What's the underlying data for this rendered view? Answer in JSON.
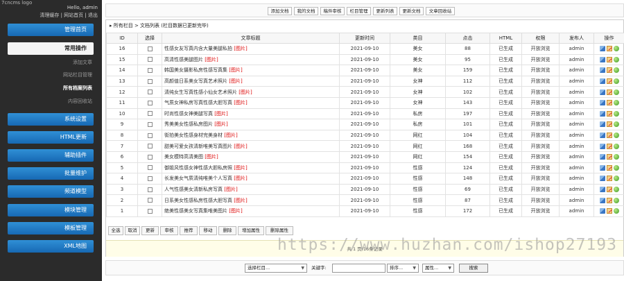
{
  "sidebar": {
    "logo": "7cncms logo",
    "hello": "Hello, admin",
    "links": [
      "清理缓存",
      "网站首页",
      "退出"
    ],
    "link_sep": "|",
    "items": [
      {
        "label": "管理首页",
        "type": "button"
      },
      {
        "label": "常用操作",
        "type": "white"
      },
      {
        "label": "添加文章",
        "type": "sub"
      },
      {
        "label": "网站栏目管理",
        "type": "sub"
      },
      {
        "label": "所有档案列表",
        "type": "sub-active"
      },
      {
        "label": "内容回收站",
        "type": "sub"
      },
      {
        "label": "系统设置",
        "type": "button"
      },
      {
        "label": "HTML更新",
        "type": "button"
      },
      {
        "label": "辅助插件",
        "type": "button"
      },
      {
        "label": "批量维护",
        "type": "button"
      },
      {
        "label": "频道模型",
        "type": "button"
      },
      {
        "label": "模块管理",
        "type": "button"
      },
      {
        "label": "模板管理",
        "type": "button"
      },
      {
        "label": "XML地图",
        "type": "button"
      }
    ]
  },
  "toolbar": [
    "添加文档",
    "我的文档",
    "稿件审核",
    "栏目管理",
    "更新列表",
    "更新文档",
    "文章回收站"
  ],
  "breadcrumb": "▸ 所有栏目 > 文档列表  (栏目数据已更新完毕)",
  "table": {
    "headers": [
      "ID",
      "选择",
      "文章标题",
      "更新时间",
      "类目",
      "点击",
      "HTML",
      "权限",
      "发布人",
      "操作"
    ],
    "pic_tag": "[图片]",
    "rows": [
      {
        "id": "16",
        "title": "性感女友写真内含大量美腿私拍",
        "date": "2021-09-10",
        "cat": "美女",
        "clicks": "88",
        "html": "已生成",
        "perm": "开放浏览",
        "author": "admin"
      },
      {
        "id": "15",
        "title": "高清性感美腿图片",
        "date": "2021-09-10",
        "cat": "美女",
        "clicks": "95",
        "html": "已生成",
        "perm": "开放浏览",
        "author": "admin"
      },
      {
        "id": "14",
        "title": "韩国美女摄影私房性感写真集",
        "date": "2021-09-10",
        "cat": "美女",
        "clicks": "159",
        "html": "已生成",
        "perm": "开放浏览",
        "author": "admin"
      },
      {
        "id": "13",
        "title": "高颜值日系美女写真艺术照片",
        "date": "2021-09-10",
        "cat": "女神",
        "clicks": "112",
        "html": "已生成",
        "perm": "开放浏览",
        "author": "admin"
      },
      {
        "id": "12",
        "title": "清纯女生写真性感小仙女艺术照片",
        "date": "2021-09-10",
        "cat": "女神",
        "clicks": "102",
        "html": "已生成",
        "perm": "开放浏览",
        "author": "admin"
      },
      {
        "id": "11",
        "title": "气质女神私房写真性感大胆写真",
        "date": "2021-09-10",
        "cat": "女神",
        "clicks": "143",
        "html": "已生成",
        "perm": "开放浏览",
        "author": "admin"
      },
      {
        "id": "10",
        "title": "时尚性感女神美腿写真",
        "date": "2021-09-10",
        "cat": "私房",
        "clicks": "197",
        "html": "已生成",
        "perm": "开放浏览",
        "author": "admin"
      },
      {
        "id": "9",
        "title": "秀美美女性感私房图片",
        "date": "2021-09-10",
        "cat": "私房",
        "clicks": "101",
        "html": "已生成",
        "perm": "开放浏览",
        "author": "admin"
      },
      {
        "id": "8",
        "title": "街拍美女性感身材完美身材",
        "date": "2021-09-10",
        "cat": "网红",
        "clicks": "104",
        "html": "已生成",
        "perm": "开放浏览",
        "author": "admin"
      },
      {
        "id": "7",
        "title": "甜美可爱女孩清新唯美写真图片",
        "date": "2021-09-10",
        "cat": "网红",
        "clicks": "168",
        "html": "已生成",
        "perm": "开放浏览",
        "author": "admin"
      },
      {
        "id": "6",
        "title": "美女模特高清美图",
        "date": "2021-09-10",
        "cat": "网红",
        "clicks": "154",
        "html": "已生成",
        "perm": "开放浏览",
        "author": "admin"
      },
      {
        "id": "5",
        "title": "御姐风性感女神性感大胆私房照",
        "date": "2021-09-10",
        "cat": "性感",
        "clicks": "124",
        "html": "已生成",
        "perm": "开放浏览",
        "author": "admin"
      },
      {
        "id": "4",
        "title": "长发美女气质清纯唯美个人写真",
        "date": "2021-09-10",
        "cat": "性感",
        "clicks": "148",
        "html": "已生成",
        "perm": "开放浏览",
        "author": "admin"
      },
      {
        "id": "3",
        "title": "人气性感美女清新私房写真",
        "date": "2021-09-10",
        "cat": "性感",
        "clicks": "69",
        "html": "已生成",
        "perm": "开放浏览",
        "author": "admin"
      },
      {
        "id": "2",
        "title": "日系美女性感私房性感大胆写真",
        "date": "2021-09-10",
        "cat": "性感",
        "clicks": "87",
        "html": "已生成",
        "perm": "开放浏览",
        "author": "admin"
      },
      {
        "id": "1",
        "title": "绝美性感美女写真集唯美图片",
        "date": "2021-09-10",
        "cat": "性感",
        "clicks": "172",
        "html": "已生成",
        "perm": "开放浏览",
        "author": "admin"
      }
    ]
  },
  "bulk_actions": [
    "全选",
    "取消",
    "更新",
    "审核",
    "推荐",
    "移动",
    "删除",
    "增加属性",
    "删除属性"
  ],
  "pager": "共 1 页/16条记录",
  "search": {
    "column_select": "选择栏目...",
    "keyword_label": "关键字:",
    "keyword_value": "",
    "sort_select": "排序...",
    "attr_select": "属性...",
    "submit_label": "搜索"
  },
  "watermark": "https://www.huzhan.com/ishop27193"
}
